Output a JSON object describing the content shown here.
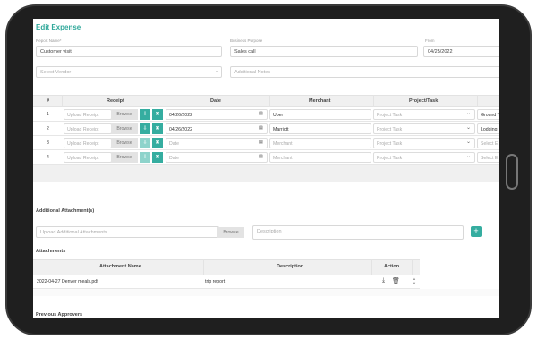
{
  "form": {
    "title": "Edit Expense",
    "report_name_label": "Report Name*",
    "report_name_value": "Customer visit",
    "business_purpose_label": "Business Purpose",
    "business_purpose_value": "Sales call",
    "from_label": "From",
    "from_value": "04/25/2022",
    "vendor_placeholder": "Select Vendor",
    "notes_placeholder": "Additional Notes"
  },
  "expense_table": {
    "columns": [
      "#",
      "Receipt",
      "Date",
      "Merchant",
      "Project/Task"
    ],
    "upload_placeholder": "Upload Receipt",
    "browse_label": "Browse",
    "date_placeholder": "Date",
    "merchant_placeholder": "Merchant",
    "project_placeholder": "Project Task",
    "rows": [
      {
        "num": "1",
        "date": "04/26/2022",
        "merchant": "Uber",
        "extra": "Ground T"
      },
      {
        "num": "2",
        "date": "04/26/2022",
        "merchant": "Marriott",
        "extra": "Lodging"
      },
      {
        "num": "3",
        "date": "",
        "merchant": "",
        "extra": "Select E"
      },
      {
        "num": "4",
        "date": "",
        "merchant": "",
        "extra": "Select E"
      }
    ]
  },
  "additional": {
    "title": "Additional Attachment(s)",
    "upload_placeholder": "Upload Additional Attachments",
    "browse_label": "Browse",
    "description_placeholder": "Description",
    "add_label": "+"
  },
  "attachments": {
    "title": "Attachments",
    "columns": [
      "Attachment Name",
      "Description",
      "Action"
    ],
    "rows": [
      {
        "name": "2022-04-27 Denver meals.pdf",
        "description": "trip report"
      }
    ]
  },
  "approvers": {
    "title": "Previous Approvers"
  },
  "icons": {
    "download": "download-icon",
    "delete": "close-icon",
    "calendar": "calendar-icon",
    "trash": "trash-icon",
    "chevron": "chevron-down-icon"
  },
  "colors": {
    "accent": "#35ada0",
    "title": "#2fa89a"
  }
}
